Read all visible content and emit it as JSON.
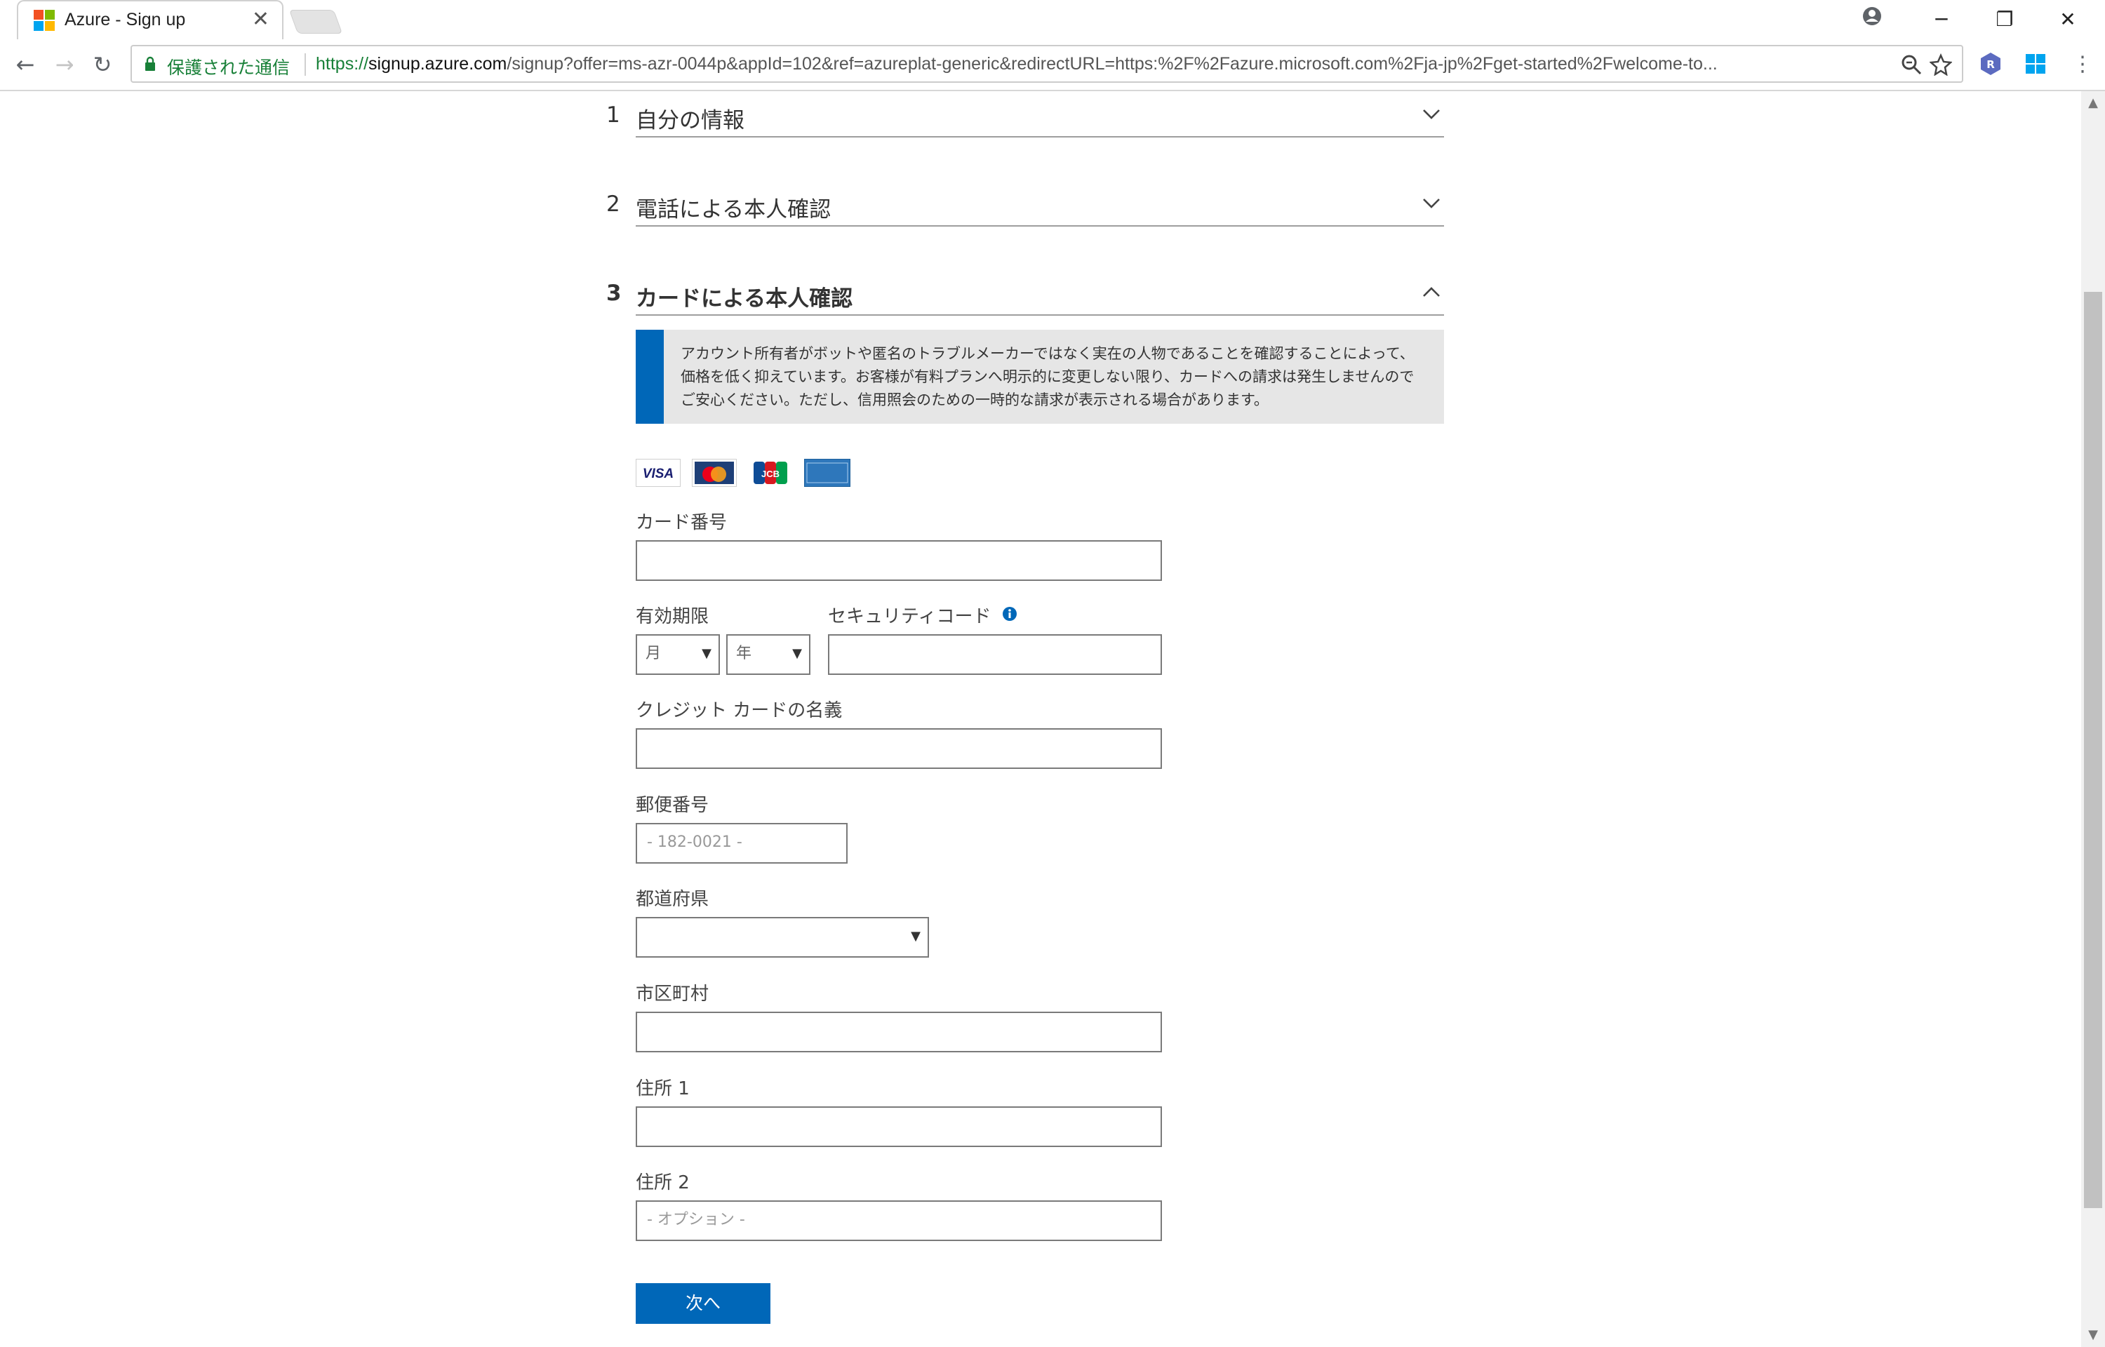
{
  "browser": {
    "tab_title": "Azure - Sign up",
    "tab_close": "✕",
    "secure_label": "保護された通信",
    "url_scheme": "https://",
    "url_host": "signup.azure.com",
    "url_rest": "/signup?offer=ms-azr-0044p&appId=102&ref=azureplat-generic&redirectURL=https:%2F%2Fazure.microsoft.com%2Fja-jp%2Fget-started%2Fwelcome-to...",
    "window_minimize": "─",
    "window_restore": "❐",
    "window_close": "✕",
    "nav_back": "←",
    "nav_forward": "→",
    "nav_reload": "↻"
  },
  "steps": [
    {
      "number": "1",
      "title": "自分の情報",
      "expanded": false
    },
    {
      "number": "2",
      "title": "電話による本人確認",
      "expanded": false
    },
    {
      "number": "3",
      "title": "カードによる本人確認",
      "expanded": true
    }
  ],
  "info": {
    "text": "アカウント所有者がボットや匿名のトラブルメーカーではなく実在の人物であることを確認することによって、価格を低く抑えています。お客様が有料プランへ明示的に変更しない限り、カードへの請求は発生しませんのでご安心ください。ただし、信用照会のための一時的な請求が表示される場合があります。"
  },
  "cards": [
    {
      "name": "VISA"
    },
    {
      "name": "MasterCard"
    },
    {
      "name": "JCB"
    },
    {
      "name": "AMERICAN EXPRESS"
    }
  ],
  "form": {
    "card_number_label": "カード番号",
    "expiry_label": "有効期限",
    "month_value": "月",
    "year_value": "年",
    "security_code_label": "セキュリティコード",
    "cardholder_label": "クレジット カードの名義",
    "postal_label": "郵便番号",
    "postal_placeholder": "- 182-0021 -",
    "prefecture_label": "都道府県",
    "city_label": "市区町村",
    "address1_label": "住所 1",
    "address2_label": "住所 2",
    "address2_placeholder": "- オプション -",
    "next_label": "次へ"
  },
  "colors": {
    "accent": "#0067b8",
    "secure": "#188038",
    "info_bg": "#e6e6e6"
  }
}
